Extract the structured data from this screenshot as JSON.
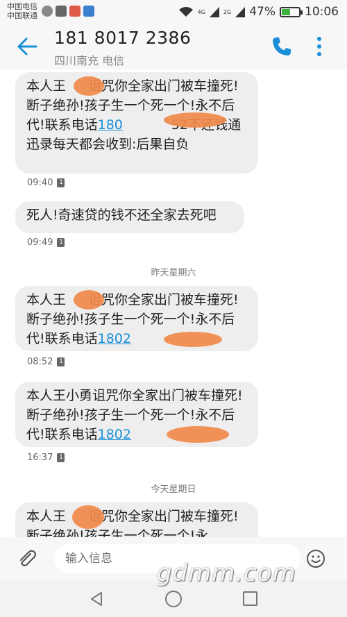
{
  "status_bar": {
    "carrier_1": "中国电信",
    "carrier_2": "中国联通",
    "network_1": "4G",
    "network_2": "2G",
    "battery": "47%",
    "battery_level": 0.47,
    "time": "10:06"
  },
  "header": {
    "title": "181 8017 2386",
    "subtitle": "四川南充 电信"
  },
  "messages": [
    {
      "text_a": "本人王",
      "text_b": "诅咒你全家出门被车撞死!断子绝孙!孩子生一个死一个!永不后代!联系电话",
      "link": "180",
      "text_c": "52不还钱通迅录每天都会收到:后果自负",
      "time": "09:40",
      "sim": "1"
    },
    {
      "text_a": "死人!奇速贷的钱不还全家去死吧",
      "time": "09:49",
      "sim": "1"
    },
    {
      "text_a": "本人王",
      "text_b": "诅咒你全家出门被车撞死!断子绝孙!孩子生一个死一个!永不后代!联系电话",
      "link": "1802",
      "text_c": "",
      "time": "08:52",
      "sim": "1"
    },
    {
      "text_a": "本人王小勇诅咒你全家出门被车撞死!断子绝孙!孩子生一个死一个!永不后代!联系电话",
      "link": "1802",
      "time": "16:37",
      "sim": "1"
    },
    {
      "text_a": "本人王",
      "text_b": "诅咒你全家出门被车撞死!断子绝孙!孩子生一个死一个!永"
    }
  ],
  "separators": {
    "yesterday": "昨天星期六",
    "today": "今天星期日"
  },
  "input": {
    "placeholder": "输入信息"
  },
  "watermark": "gdmm.com",
  "colors": {
    "accent": "#1a8fd8",
    "bubble": "#eeeeee",
    "battery_fill": "#3fb33f",
    "redaction": "#f08a4b"
  },
  "icons": [
    "back-arrow-icon",
    "phone-icon",
    "more-vert-icon",
    "paperclip-icon",
    "emoji-icon",
    "nav-back-icon",
    "nav-home-icon",
    "nav-recent-icon"
  ]
}
